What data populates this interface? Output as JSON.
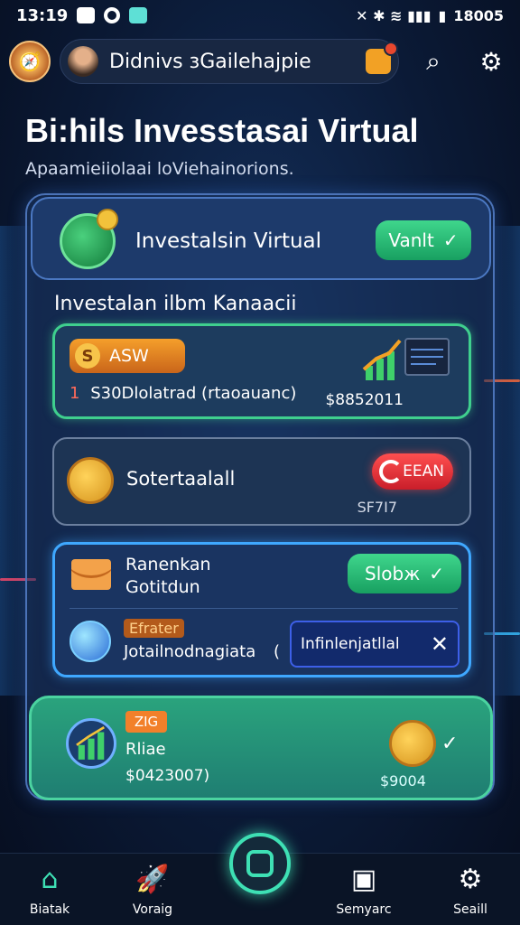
{
  "status_bar": {
    "time": "13:19",
    "right": "18005"
  },
  "header": {
    "search_text": "Didnivs зGailehajpie"
  },
  "page": {
    "title": "Bi:hils Invesstasai Virtual",
    "subtitle": "Apaamieiiolaai loViehainorions."
  },
  "top_card": {
    "label": "Investalsin Virtual",
    "button": "Vanlt"
  },
  "section": {
    "title": "Investalan ilbm Kanaacii"
  },
  "card1": {
    "badge": "ASW",
    "badge_icon": "S",
    "number": "1",
    "desc": "S30Dlolatrad (rtaoauanc)",
    "amount": "$8852011"
  },
  "card2": {
    "label": "Sotertaalall",
    "button": "EEAN",
    "small": "SF7I7"
  },
  "card3": {
    "title_line1": "Ranenkan",
    "title_line2": "Gotitdun",
    "button": "Slobж",
    "tag": "Efrater",
    "text": "Jotailnodnagiata",
    "paren": "(",
    "input_value": "Infinlenjatllal"
  },
  "card4": {
    "tag": "ZIG",
    "label": "Rliae",
    "amount": "$0423007)",
    "coin_amount": "$9004"
  },
  "bottom_nav": [
    {
      "label": "Biatak",
      "icon": "home-icon"
    },
    {
      "label": "Voraig",
      "icon": "rocket-icon"
    },
    {
      "label": "Semyarc",
      "icon": "bag-icon"
    },
    {
      "label": "Seaill",
      "icon": "gear-icon"
    }
  ],
  "colors": {
    "accent_green": "#3fd68c",
    "accent_blue": "#3fa8ff",
    "accent_red": "#ff4f4f",
    "background": "#0b1a36"
  }
}
